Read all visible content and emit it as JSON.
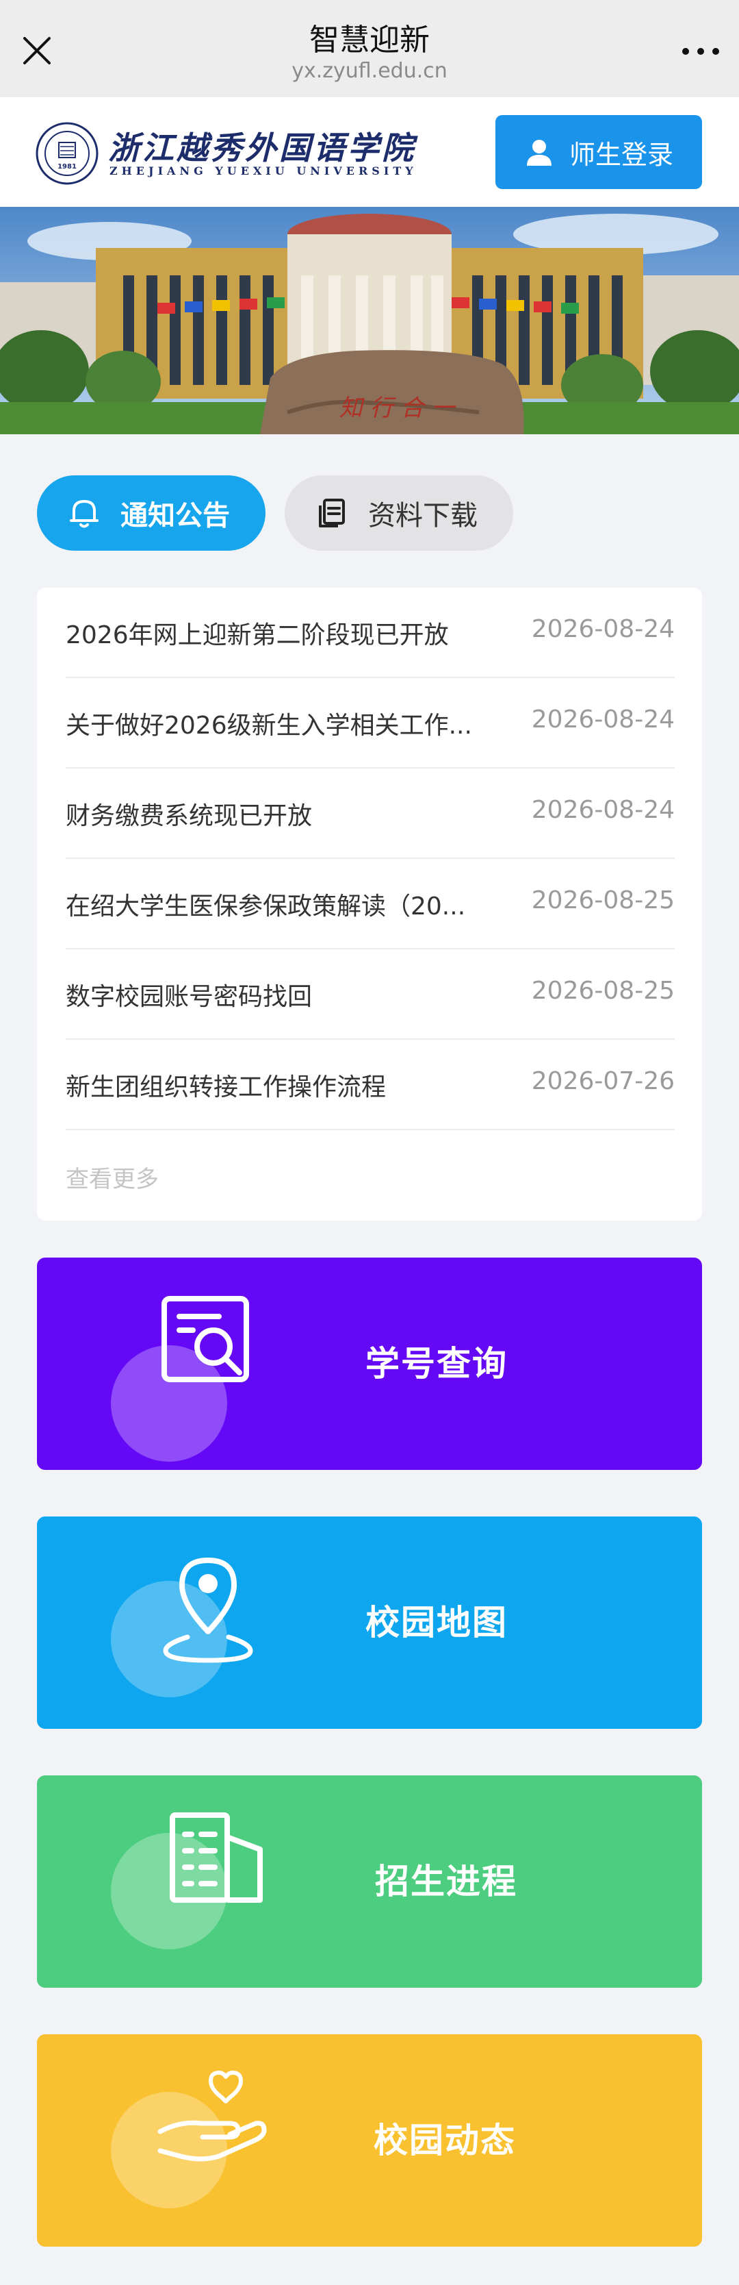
{
  "nav": {
    "title": "智慧迎新",
    "url": "yx.zyufl.edu.cn",
    "close_icon": "close-icon",
    "more_icon": "more-icon"
  },
  "header": {
    "school_name_cn": "浙江越秀外国语学院",
    "school_name_en": "ZHEJIANG YUEXIU UNIVERSITY",
    "logo_text": "1981",
    "login_label": "师生登录",
    "login_icon": "user-icon"
  },
  "banner": {
    "rock_text": "知 行 合 一",
    "colors": {
      "sky": "#6f9fd3",
      "building": "#c9a24a",
      "grass": "#4f8c36"
    }
  },
  "tabs": [
    {
      "label": "通知公告",
      "icon": "bell-icon",
      "active": true
    },
    {
      "label": "资料下载",
      "icon": "document-copy-icon",
      "active": false
    }
  ],
  "notices": [
    {
      "title": "2026年网上迎新第二阶段现已开放",
      "date": "2026-08-24"
    },
    {
      "title": "关于做好2026级新生入学相关工作...",
      "date": "2026-08-24"
    },
    {
      "title": "财务缴费系统现已开放",
      "date": "2026-08-24"
    },
    {
      "title": "在绍大学生医保参保政策解读（20...",
      "date": "2026-08-25"
    },
    {
      "title": "数字校园账号密码找回",
      "date": "2026-08-25"
    },
    {
      "title": "新生团组织转接工作操作流程",
      "date": "2026-07-26"
    }
  ],
  "notices_more": "查看更多",
  "features": [
    {
      "label": "学号查询",
      "icon": "search-document-icon",
      "color": "#6508f5"
    },
    {
      "label": "校园地图",
      "icon": "map-pin-icon",
      "color": "#0ea6ef"
    },
    {
      "label": "招生进程",
      "icon": "building-icon",
      "color": "#4ccd7f"
    },
    {
      "label": "校园动态",
      "icon": "heart-hand-icon",
      "color": "#f9c12f"
    }
  ]
}
